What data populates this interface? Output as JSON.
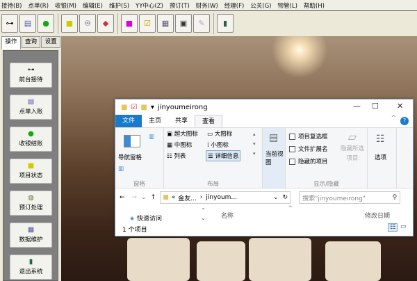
{
  "menu": [
    "接待(B)",
    "点单(R)",
    "收银(M)",
    "编辑(E)",
    "维护(S)",
    "YY中心(Z)",
    "预订(T)",
    "财务(W)",
    "经理(F)",
    "公关(G)",
    "物管(L)",
    "帮助(H)"
  ],
  "left_tabs": [
    "操作",
    "查询",
    "设置"
  ],
  "left_buttons": [
    {
      "label": "前台接待",
      "icon": "key-icon"
    },
    {
      "label": "点单入账",
      "icon": "order-icon"
    },
    {
      "label": "收银结账",
      "icon": "money-bag-icon"
    },
    {
      "label": "项目状态",
      "icon": "project-status-icon"
    },
    {
      "label": "预订处理",
      "icon": "clock-icon"
    },
    {
      "label": "数据维护",
      "icon": "database-icon"
    },
    {
      "label": "退出系统",
      "icon": "exit-door-icon"
    }
  ],
  "explorer": {
    "title": "jinyoumeirong",
    "tabs": [
      "文件",
      "主页",
      "共享",
      "查看"
    ],
    "pane": {
      "nav_pane": "导航窗格",
      "group": "窗格"
    },
    "layout": {
      "items": [
        "超大图标",
        "大图标",
        "中图标",
        "小图标",
        "列表",
        "详细信息"
      ],
      "group": "布局"
    },
    "current_view": "当前视图",
    "show_hide": {
      "checks": [
        "项目复选框",
        "文件扩展名",
        "隐藏的项目"
      ],
      "hide_selected": "隐藏所选项目",
      "group": "显示/隐藏"
    },
    "options": "选项",
    "address": {
      "prefix": "«",
      "part1": "金友...",
      "part2": "jinyoum..."
    },
    "search_placeholder": "搜索\"jinyoumeirong\"",
    "quick_access": "快速访问",
    "col_name": "名称",
    "col_date": "修改日期",
    "status": "1 个项目"
  }
}
